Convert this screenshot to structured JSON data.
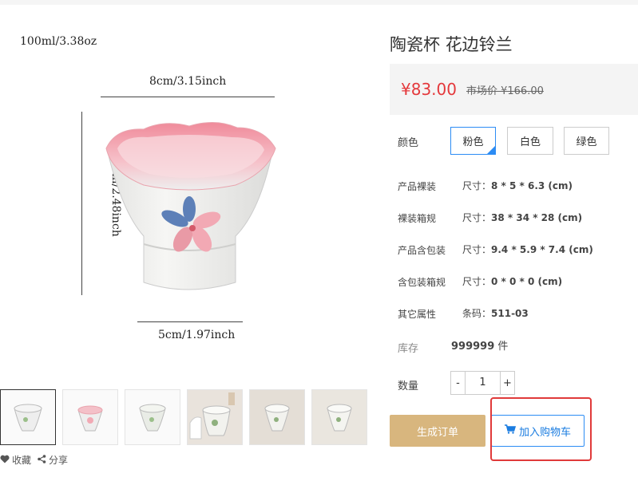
{
  "product": {
    "title": "陶瓷杯 花边铃兰",
    "price": "¥83.00",
    "market_price": "市场价 ¥166.00"
  },
  "image": {
    "volume": "100ml/3.38oz",
    "width_label": "8cm/3.15inch",
    "height_label": "6.3cm/2.48inch",
    "base_label": "5cm/1.97inch"
  },
  "color": {
    "label": "颜色",
    "options": [
      "粉色",
      "白色",
      "绿色"
    ],
    "selected": "粉色"
  },
  "specs": [
    {
      "label": "产品裸装",
      "prefix": "尺寸：",
      "value": "8 * 5 * 6.3 (cm)"
    },
    {
      "label": "裸装箱规",
      "prefix": "尺寸：",
      "value": "38 * 34 * 28 (cm)"
    },
    {
      "label": "产品含包装",
      "prefix": "尺寸：",
      "value": "9.4 * 5.9 * 7.4 (cm)"
    },
    {
      "label": "含包装箱规",
      "prefix": "尺寸：",
      "value": "0 * 0 * 0 (cm)"
    },
    {
      "label": "其它属性",
      "prefix": "条码：",
      "value": "511-03"
    }
  ],
  "stock": {
    "label": "库存",
    "value": "999999",
    "unit": "件"
  },
  "quantity": {
    "label": "数量",
    "value": "1",
    "minus": "-",
    "plus": "+"
  },
  "buttons": {
    "order": "生成订单",
    "cart": "加入购物车"
  },
  "actions": {
    "favorite": "收藏",
    "share": "分享"
  },
  "colors": {
    "price": "#e4393c",
    "accent": "#2c8cf4",
    "order_button": "#d8b67e",
    "highlight": "#e03a3a"
  }
}
